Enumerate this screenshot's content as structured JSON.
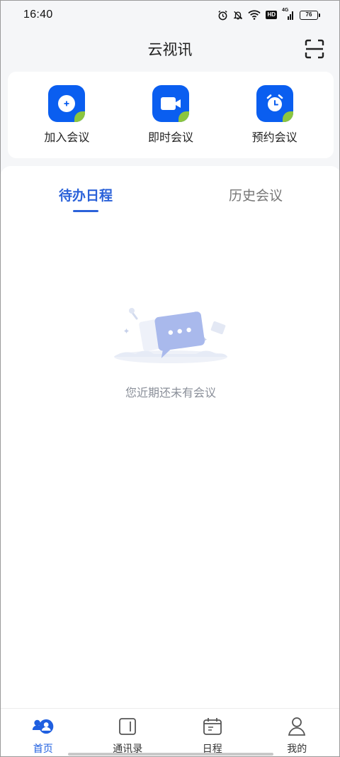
{
  "status_bar": {
    "time": "16:40",
    "hd": "HD",
    "network": "4G",
    "battery": "76",
    "icons": [
      "alarm-icon",
      "mute-bell-icon",
      "wifi-icon",
      "hd-badge",
      "signal-4g-icon",
      "battery-icon"
    ]
  },
  "header": {
    "title": "云视讯",
    "scan_icon": "scan-icon"
  },
  "quick_actions": [
    {
      "label": "加入会议",
      "icon": "plus-icon"
    },
    {
      "label": "即时会议",
      "icon": "video-camera-icon"
    },
    {
      "label": "预约会议",
      "icon": "alarm-clock-icon"
    }
  ],
  "tabs": [
    {
      "label": "待办日程",
      "active": true
    },
    {
      "label": "历史会议",
      "active": false
    }
  ],
  "empty_state": {
    "message": "您近期还未有会议",
    "icon": "chat-bubble-illustration"
  },
  "bottom_nav": [
    {
      "label": "首页",
      "icon": "home-users-icon",
      "active": true
    },
    {
      "label": "通讯录",
      "icon": "contacts-book-icon",
      "active": false
    },
    {
      "label": "日程",
      "icon": "calendar-icon",
      "active": false
    },
    {
      "label": "我的",
      "icon": "profile-icon",
      "active": false
    }
  ],
  "colors": {
    "accent": "#2b62d9",
    "icon_blue": "#0a5ef0",
    "leaf_green": "#8cc63f",
    "background": "#f5f6f8",
    "muted_text": "#8a8f99"
  }
}
